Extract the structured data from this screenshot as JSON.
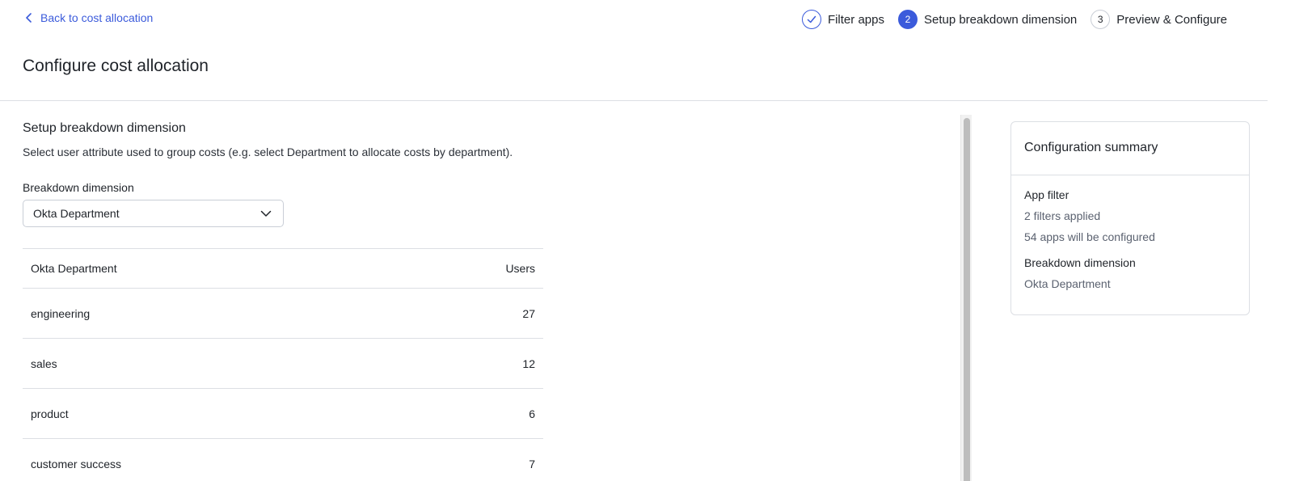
{
  "nav": {
    "back_label": "Back to cost allocation"
  },
  "stepper": {
    "steps": [
      {
        "number": "1",
        "label": "Filter apps",
        "state": "done"
      },
      {
        "number": "2",
        "label": "Setup breakdown dimension",
        "state": "active"
      },
      {
        "number": "3",
        "label": "Preview & Configure",
        "state": "todo"
      }
    ]
  },
  "page": {
    "title": "Configure cost allocation"
  },
  "section": {
    "title": "Setup breakdown dimension",
    "description": "Select user attribute used to group costs (e.g. select Department to allocate costs by department).",
    "field_label": "Breakdown dimension",
    "select_value": "Okta Department"
  },
  "table": {
    "headers": [
      "Okta Department",
      "Users"
    ],
    "rows": [
      {
        "name": "engineering",
        "users": "27"
      },
      {
        "name": "sales",
        "users": "12"
      },
      {
        "name": "product",
        "users": "6"
      },
      {
        "name": "customer success",
        "users": "7"
      }
    ]
  },
  "summary": {
    "title": "Configuration summary",
    "app_filter_label": "App filter",
    "filters_applied": "2 filters applied",
    "apps_configured": "54 apps will be configured",
    "breakdown_label": "Breakdown dimension",
    "breakdown_value": "Okta Department"
  },
  "colors": {
    "accent": "#3b5bdb",
    "border": "#dcdfe4",
    "muted_text": "#5b6270"
  },
  "icons": {
    "back": "chevron-left-icon",
    "done_step": "check-icon",
    "select": "chevron-down-icon"
  }
}
